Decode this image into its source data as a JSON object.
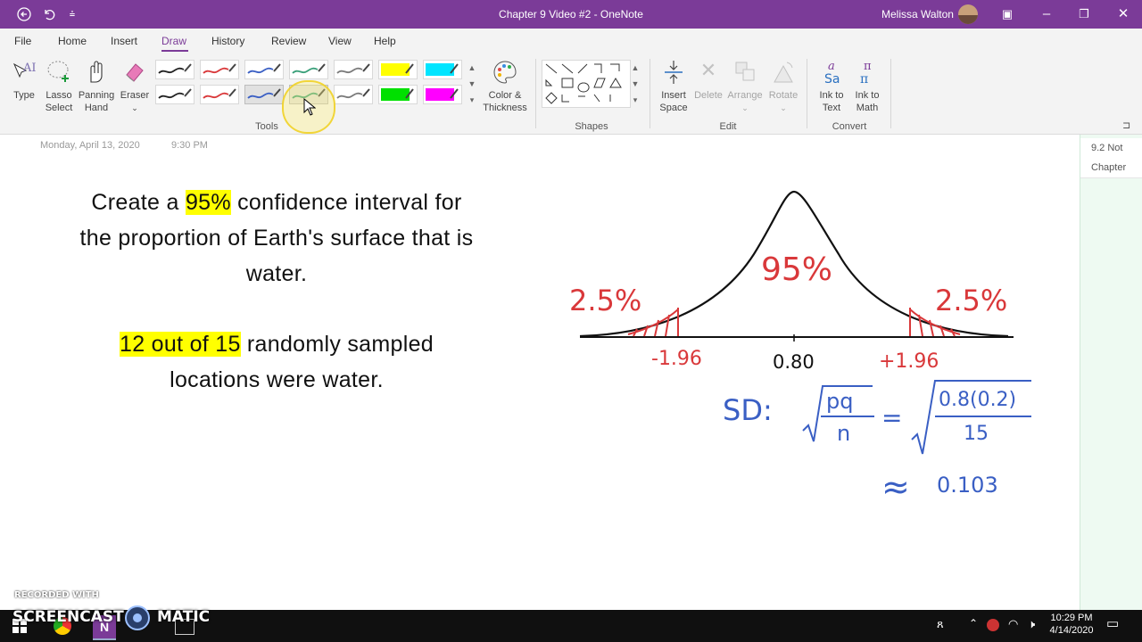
{
  "window": {
    "title": "Chapter 9 Video #2  -  OneNote",
    "user": "Melissa Walton",
    "back_icon": "back-arrow-icon",
    "undo_icon": "undo-icon",
    "quick_access_icon": "customize-qat-icon"
  },
  "menu": {
    "items": [
      "File",
      "Home",
      "Insert",
      "Draw",
      "History",
      "Review",
      "View",
      "Help"
    ],
    "active": "Draw"
  },
  "ribbon": {
    "tools": {
      "type_label": "Type",
      "lasso_label_1": "Lasso",
      "lasso_label_2": "Select",
      "panning_label_1": "Panning",
      "panning_label_2": "Hand",
      "eraser_label": "Eraser",
      "color_label_1": "Color &",
      "color_label_2": "Thickness",
      "group": "Tools"
    },
    "pens_row1": [
      "#222222",
      "#d9383a",
      "#3a5fc4",
      "#3aa07a",
      "#7a7a7a",
      "#ffff00",
      "#00e5ff"
    ],
    "pens_row2": [
      "#222222",
      "#d9383a",
      "#3a5fc4",
      "#3aa07a",
      "#7a7a7a",
      "#00e000",
      "#ff00ff"
    ],
    "shapes_group": "Shapes",
    "edit": {
      "insert_space_1": "Insert",
      "insert_space_2": "Space",
      "delete": "Delete",
      "arrange": "Arrange",
      "rotate": "Rotate",
      "group": "Edit"
    },
    "convert": {
      "ink_text_1": "Ink to",
      "ink_text_2": "Text",
      "ink_math_1": "Ink to",
      "ink_math_2": "Math",
      "group": "Convert"
    }
  },
  "page": {
    "date": "Monday, April 13, 2020",
    "time": "9:30 PM",
    "problem": {
      "line1_pre": "Create a ",
      "line1_hl": "95%",
      "line1_post": " confidence interval for",
      "line2": "the proportion of Earth's surface that is",
      "line3": "water.",
      "line4_hl": "12 out of 15",
      "line4_post": " randomly sampled",
      "line5": "locations were water."
    },
    "diagram": {
      "center_pct": "95%",
      "left_tail": "2.5%",
      "right_tail": "2.5%",
      "left_z": "-1.96",
      "right_z": "+1.96",
      "center_value": "0.80"
    },
    "sd": {
      "label": "SD:",
      "num": "pq",
      "den": "n",
      "eq": "=",
      "num2": "0.8(0.2)",
      "den2": "15",
      "approx": "≈",
      "result": "0.103"
    }
  },
  "right_pane": {
    "tab1": "9.2 Not",
    "tab2": "Chapter"
  },
  "watermark": {
    "line1": "RECORDED WITH",
    "brand_left": "SCREENCAST",
    "brand_right": "MATIC"
  },
  "taskbar": {
    "time": "10:29 PM",
    "date": "4/14/2020"
  }
}
